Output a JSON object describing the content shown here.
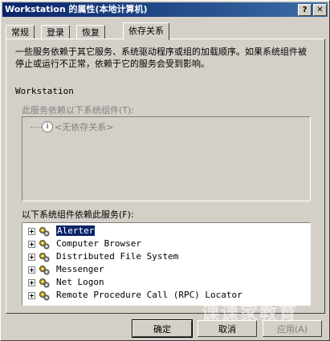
{
  "window": {
    "title": "Workstation 的属性(本地计算机)",
    "help_label": "?",
    "close_label": "✕"
  },
  "tabs": [
    {
      "label": "常规"
    },
    {
      "label": "登录"
    },
    {
      "label": "恢复"
    },
    {
      "label": "依存关系",
      "active": true
    }
  ],
  "description": "一些服务依赖于其它服务、系统驱动程序或组的加载顺序。如果系统组件被停止或运行不正常，依赖于它的服务会受到影响。",
  "service_name": "Workstation",
  "depends_on": {
    "label": "此服务依赖以下系统组件(T):",
    "items": [
      {
        "label": "<无依存关系>",
        "icon": "info-icon"
      }
    ]
  },
  "dependents": {
    "label": "以下系统组件依赖此服务(F):",
    "items": [
      {
        "label": "Alerter",
        "selected": true
      },
      {
        "label": "Computer Browser"
      },
      {
        "label": "Distributed File System"
      },
      {
        "label": "Messenger"
      },
      {
        "label": "Net Logon"
      },
      {
        "label": "Remote Procedure Call (RPC) Locator"
      }
    ]
  },
  "buttons": {
    "ok": "确定",
    "cancel": "取消",
    "apply": "应用(A)"
  },
  "watermark": "课课家教育",
  "colors": {
    "title_start": "#0a246a",
    "title_end": "#3a6ea5",
    "selection": "#0a246a",
    "face": "#d4d0c8"
  }
}
